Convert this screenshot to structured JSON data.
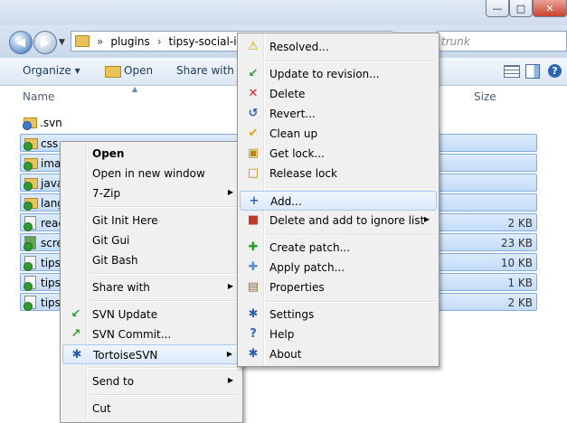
{
  "window": {
    "minimize": "—",
    "maximize": "□",
    "close": "✕"
  },
  "nav": {
    "back_icon": "arrow-left-icon",
    "forward_icon": "arrow-right-icon",
    "breadcrumb": [
      "plugins",
      "tipsy-social-ico"
    ],
    "search_placeholder": "trunk"
  },
  "toolbar": {
    "organize": "Organize ▾",
    "open": "Open",
    "share_with": "Share with ▾"
  },
  "columns": {
    "name": "Name",
    "size": "Size"
  },
  "files": [
    {
      "name": ".svn",
      "size": "",
      "type": "folder",
      "selected": false
    },
    {
      "name": "css",
      "size": "",
      "type": "folder",
      "selected": true
    },
    {
      "name": "ima",
      "size": "",
      "type": "folder",
      "selected": true
    },
    {
      "name": "java",
      "size": "",
      "type": "folder",
      "selected": true
    },
    {
      "name": "lang",
      "size": "",
      "type": "folder",
      "selected": true
    },
    {
      "name": "reac",
      "size": "2 KB",
      "type": "file",
      "selected": true
    },
    {
      "name": "scre",
      "size": "23 KB",
      "type": "file",
      "selected": true
    },
    {
      "name": "tipsy",
      "size": "10 KB",
      "type": "file",
      "selected": true
    },
    {
      "name": "tipsy",
      "size": "1 KB",
      "type": "file",
      "selected": true
    },
    {
      "name": "tipsy",
      "size": "2 KB",
      "type": "file",
      "selected": true
    }
  ],
  "context_menu": [
    {
      "label": "Open",
      "bold": true,
      "submenu": false,
      "icon": ""
    },
    {
      "label": "Open in new window",
      "submenu": false,
      "icon": ""
    },
    {
      "label": "7-Zip",
      "submenu": true,
      "icon": ""
    },
    {
      "sep": true
    },
    {
      "label": "Git Init Here",
      "submenu": false,
      "icon": ""
    },
    {
      "label": "Git Gui",
      "submenu": false,
      "icon": ""
    },
    {
      "label": "Git Bash",
      "submenu": false,
      "icon": ""
    },
    {
      "sep": true
    },
    {
      "label": "Share with",
      "submenu": true,
      "icon": ""
    },
    {
      "sep": true
    },
    {
      "label": "SVN Update",
      "submenu": false,
      "icon": "svn-update-icon"
    },
    {
      "label": "SVN Commit...",
      "submenu": false,
      "icon": "svn-commit-icon"
    },
    {
      "label": "TortoiseSVN",
      "submenu": true,
      "icon": "tortoisesvn-icon",
      "highlighted": true
    },
    {
      "sep": true
    },
    {
      "label": "Send to",
      "submenu": true,
      "icon": ""
    },
    {
      "sep": true
    },
    {
      "label": "Cut",
      "submenu": false,
      "icon": ""
    }
  ],
  "svn_menu": [
    {
      "label": "Resolved...",
      "icon": "resolved-icon",
      "submenu": false
    },
    {
      "sep": true
    },
    {
      "label": "Update to revision...",
      "icon": "update-icon",
      "submenu": false
    },
    {
      "label": "Delete",
      "icon": "delete-icon",
      "submenu": false
    },
    {
      "label": "Revert...",
      "icon": "revert-icon",
      "submenu": false
    },
    {
      "label": "Clean up",
      "icon": "cleanup-icon",
      "submenu": false
    },
    {
      "label": "Get lock...",
      "icon": "lock-icon",
      "submenu": false
    },
    {
      "label": "Release lock",
      "icon": "unlock-icon",
      "submenu": false
    },
    {
      "sep": true
    },
    {
      "label": "Add...",
      "icon": "add-icon",
      "submenu": false,
      "highlighted": true
    },
    {
      "label": "Delete and add to ignore list",
      "icon": "ignore-icon",
      "submenu": true
    },
    {
      "sep": true
    },
    {
      "label": "Create patch...",
      "icon": "create-patch-icon",
      "submenu": false
    },
    {
      "label": "Apply patch...",
      "icon": "apply-patch-icon",
      "submenu": false
    },
    {
      "label": "Properties",
      "icon": "properties-icon",
      "submenu": false
    },
    {
      "sep": true
    },
    {
      "label": "Settings",
      "icon": "settings-icon",
      "submenu": false
    },
    {
      "label": "Help",
      "icon": "help-icon",
      "submenu": false
    },
    {
      "label": "About",
      "icon": "about-icon",
      "submenu": false
    }
  ],
  "colors": {
    "selection": "#c3dcf8",
    "menu_bg": "#f0f0f0",
    "highlight_border": "#a8c8ee"
  }
}
